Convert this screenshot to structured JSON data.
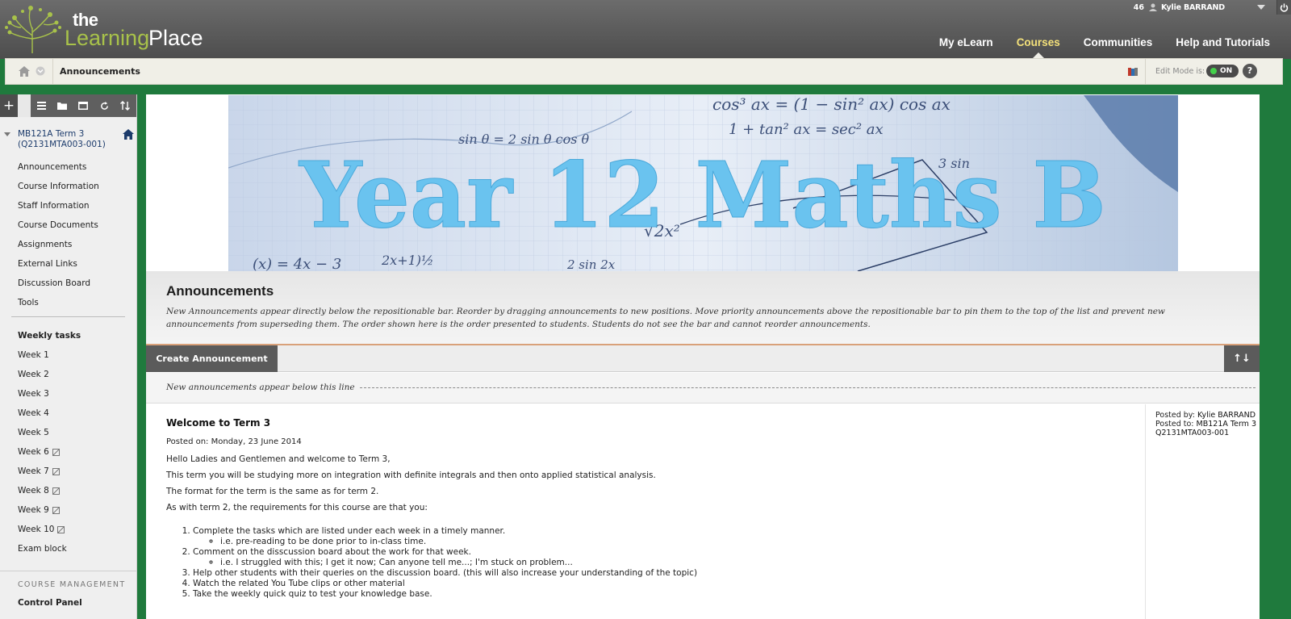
{
  "header": {
    "logo": {
      "line1": "the",
      "line2a": "Learning",
      "line2b": "Place"
    },
    "user": {
      "count": "46",
      "name": "Kylie BARRAND"
    },
    "nav": [
      {
        "label": "My eLearn",
        "active": false
      },
      {
        "label": "Courses",
        "active": true
      },
      {
        "label": "Communities",
        "active": false
      },
      {
        "label": "Help and Tutorials",
        "active": false
      }
    ]
  },
  "breadcrumb": {
    "current": "Announcements"
  },
  "edit_mode": {
    "label": "Edit Mode is:",
    "state": "ON",
    "help": "?"
  },
  "sidebar": {
    "toolbar": [
      "add-menu-item",
      "list-view",
      "folder-view",
      "window-view",
      "refresh",
      "reorder"
    ],
    "course_title": "MB121A Term 3 (Q2131MTA003-001)",
    "menu": [
      "Announcements",
      "Course Information",
      "Staff Information",
      "Course Documents",
      "Assignments",
      "External Links",
      "Discussion Board",
      "Tools"
    ],
    "weekly_heading": "Weekly tasks",
    "weeks": [
      {
        "label": "Week 1",
        "hidden": false
      },
      {
        "label": "Week 2",
        "hidden": false
      },
      {
        "label": "Week 3",
        "hidden": false
      },
      {
        "label": "Week 4",
        "hidden": false
      },
      {
        "label": "Week 5",
        "hidden": false
      },
      {
        "label": "Week 6",
        "hidden": true
      },
      {
        "label": "Week 7",
        "hidden": true
      },
      {
        "label": "Week 8",
        "hidden": true
      },
      {
        "label": "Week 9",
        "hidden": true
      },
      {
        "label": "Week 10",
        "hidden": true
      },
      {
        "label": "Exam block",
        "hidden": false
      }
    ],
    "course_management": "COURSE MANAGEMENT",
    "control_panel": "Control Panel"
  },
  "banner": {
    "text": "Year 12 Maths B"
  },
  "page": {
    "title": "Announcements",
    "description": "New Announcements appear directly below the repositionable bar. Reorder by dragging announcements to new positions. Move priority announcements above the repositionable bar to pin them to the top of the list and prevent new announcements from superseding them. The order shown here is the order presented to students. Students do not see the bar and cannot reorder announcements.",
    "create_button": "Create Announcement",
    "sort_icon": "↑↓",
    "divider_text": "New announcements appear below this line"
  },
  "announcement": {
    "title": "Welcome to Term 3",
    "posted_on": "Posted on: Monday, 23 June 2014",
    "paragraphs": [
      "Hello Ladies and Gentlemen and welcome to Term 3,",
      "This term you will be studying more on integration with definite integrals and then onto applied statistical analysis.",
      "The format for the term is the same as for term 2.",
      "As with term 2, the requirements for this course are that you:"
    ],
    "items": [
      {
        "text": "Complete the tasks which are listed under each week in a timely manner.",
        "sub": "i.e. pre-reading to be done prior to in-class time."
      },
      {
        "text": "Comment on the disscussion board about the work for that week.",
        "sub": "i.e. I struggled with this; I get it now; Can anyone tell me...; I'm stuck on problem..."
      },
      {
        "text": " Help other students with their queries on the discussion board. (this will also increase your understanding of the topic)",
        "sub": ""
      },
      {
        "text": "Watch the related You Tube clips or other material",
        "sub": ""
      },
      {
        "text": "Take the weekly quick quiz to test your knowledge base.",
        "sub": ""
      }
    ],
    "meta": {
      "posted_by_label": "Posted by:",
      "posted_by": "Kylie BARRAND",
      "posted_to_label": "Posted to:",
      "posted_to": "MB121A Term 3 Q2131MTA003-001"
    }
  },
  "colors": {
    "header_bg": "#5a5a5a",
    "accent_active": "#f4e17a",
    "brand_green": "#a8c24a",
    "page_bg": "#1f7a3d",
    "banner_text": "#6ac3ef"
  }
}
